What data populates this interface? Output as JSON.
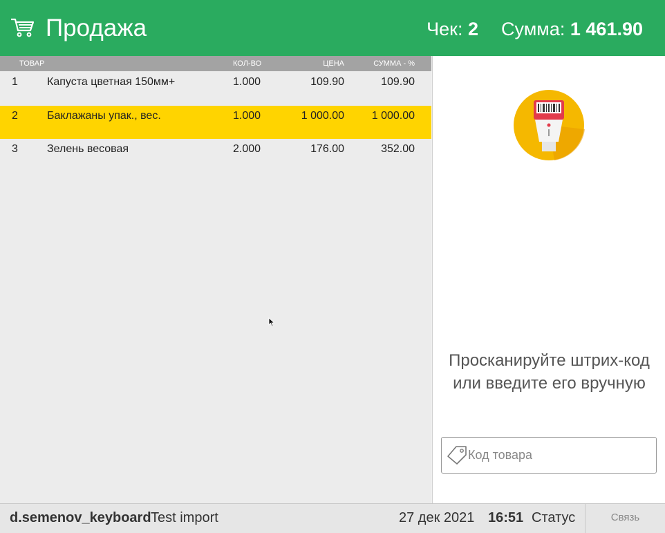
{
  "header": {
    "title": "Продажа",
    "check_label": "Чек:",
    "check_number": "2",
    "sum_label": "Сумма:",
    "sum_value": "1 461.90",
    "icon": "cart-icon",
    "bg_color": "#2aab5f"
  },
  "table": {
    "columns": {
      "name": "ТОВАР",
      "qty": "КОЛ-ВО",
      "price": "ЦЕНА",
      "sum": "СУММА - %"
    },
    "rows": [
      {
        "idx": "1",
        "name": "Капуста цветная 150мм+",
        "qty": "1.000",
        "price": "109.90",
        "sum": "109.90"
      },
      {
        "idx": "2",
        "name": "Баклажаны упак., вес.",
        "qty": "1.000",
        "price": "1 000.00",
        "sum": "1 000.00"
      },
      {
        "idx": "3",
        "name": "Зелень весовая",
        "qty": "2.000",
        "price": "176.00",
        "sum": "352.00"
      }
    ],
    "selected_row_color": "#ffd400"
  },
  "panel": {
    "scan_text": "Просканируйте штрих-код или введите его вручную",
    "code_placeholder": "Код товара",
    "icons": [
      "barcode-scanner-icon",
      "price-tag-icon"
    ]
  },
  "footer": {
    "user": "d.semenov_keyboard",
    "shop": "Test import",
    "date": "27 дек 2021",
    "time": "16:51",
    "status": "Статус",
    "link": "Связь"
  }
}
